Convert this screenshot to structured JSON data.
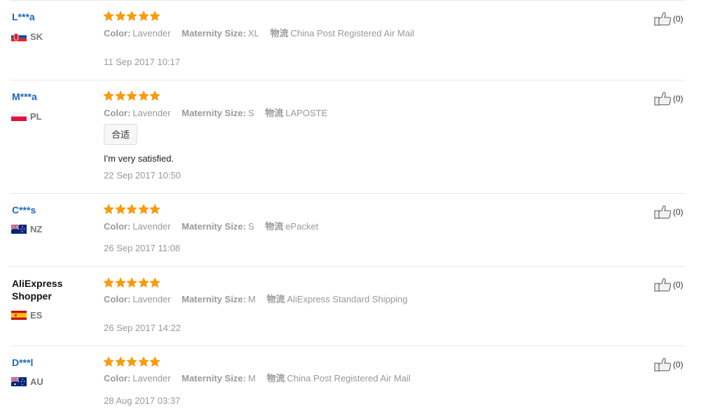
{
  "reviews": [
    {
      "name": "L***a",
      "country": "SK",
      "rating": 5,
      "color_label": "Color:",
      "color": "Lavender",
      "size_label": "Maternity Size:",
      "size": "XL",
      "ship_label": "物流",
      "shipping": "China Post Registered Air Mail",
      "tag": "",
      "text": "",
      "date": "11 Sep 2017 10:17",
      "helpful": "(0)"
    },
    {
      "name": "M***a",
      "country": "PL",
      "rating": 5,
      "color_label": "Color:",
      "color": "Lavender",
      "size_label": "Maternity Size:",
      "size": "S",
      "ship_label": "物流",
      "shipping": "LAPOSTE",
      "tag": "合适",
      "text": "I'm very satisfied.",
      "date": "22 Sep 2017 10:50",
      "helpful": "(0)"
    },
    {
      "name": "C***s",
      "country": "NZ",
      "rating": 5,
      "color_label": "Color:",
      "color": "Lavender",
      "size_label": "Maternity Size:",
      "size": "S",
      "ship_label": "物流",
      "shipping": "ePacket",
      "tag": "",
      "text": "",
      "date": "26 Sep 2017 11:08",
      "helpful": "(0)"
    },
    {
      "name": "AliExpress Shopper",
      "country": "ES",
      "rating": 5,
      "color_label": "Color:",
      "color": "Lavender",
      "size_label": "Maternity Size:",
      "size": "M",
      "ship_label": "物流",
      "shipping": "AliExpress Standard Shipping",
      "tag": "",
      "text": "",
      "date": "26 Sep 2017 14:22",
      "helpful": "(0)"
    },
    {
      "name": "D***l",
      "country": "AU",
      "rating": 5,
      "color_label": "Color:",
      "color": "Lavender",
      "size_label": "Maternity Size:",
      "size": "M",
      "ship_label": "物流",
      "shipping": "China Post Registered Air Mail",
      "tag": "",
      "text": "",
      "date": "28 Aug 2017 03:37",
      "helpful": "(0)"
    }
  ],
  "colors": {
    "name_link": "#1c68b8",
    "star": "#ff9a00",
    "meta": "#999999"
  },
  "icons": {
    "star": "star-icon",
    "helpful": "thumbs-up-icon"
  }
}
